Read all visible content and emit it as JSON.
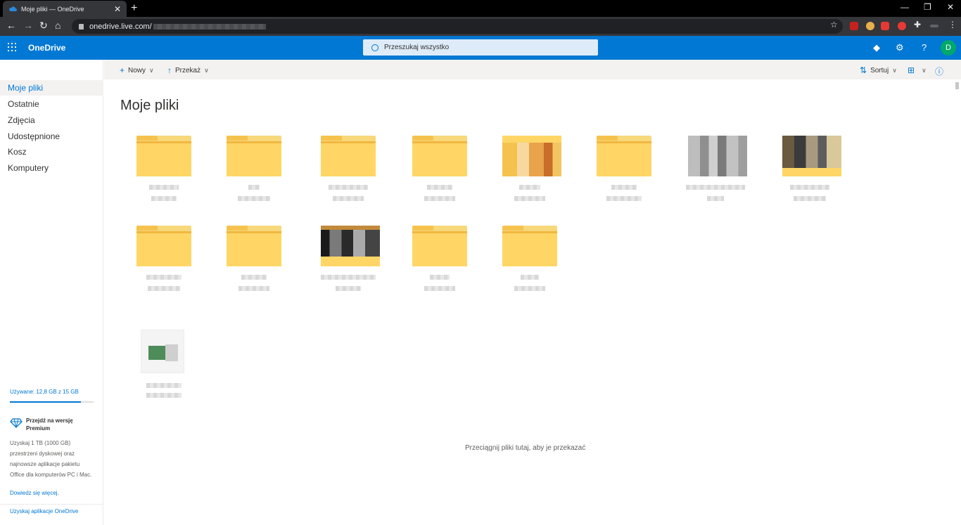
{
  "browser": {
    "tab_title": "Moje pliki — OneDrive",
    "tab_close": "✕",
    "new_tab": "+",
    "url_host": "onedrive.live.com/",
    "window_controls": [
      "—",
      "❐",
      "✕"
    ]
  },
  "header": {
    "brand": "OneDrive",
    "search_placeholder": "Przeszukaj wszystko",
    "avatar_initial": "D",
    "colors": {
      "accent": "#0078d4",
      "avatar": "#00a86b"
    }
  },
  "nav": {
    "items": [
      {
        "label": "Moje pliki",
        "active": true
      },
      {
        "label": "Ostatnie",
        "active": false
      },
      {
        "label": "Zdjęcia",
        "active": false
      },
      {
        "label": "Udostępnione",
        "active": false
      },
      {
        "label": "Kosz",
        "active": false
      },
      {
        "label": "Komputery",
        "active": false
      }
    ],
    "quota_text": "Używane: 12,8 GB z 15 GB",
    "premium_title": "Przejdź na wersję Premium",
    "premium_text": "Uzyskaj 1 TB (1000 GB) przestrzeni dyskowej oraz najnowsze aplikacje pakietu Office dla komputerów PC i Mac.",
    "learn_more": "Dowiedz się więcej.",
    "get_apps": "Uzyskaj aplikacje OneDrive"
  },
  "commandbar": {
    "new_label": "Nowy",
    "upload_label": "Przekaż",
    "sort_label": "Sortuj"
  },
  "main": {
    "title": "Moje pliki",
    "drop_message": "Przeciągnij pliki tutaj, aby je przekazać"
  }
}
